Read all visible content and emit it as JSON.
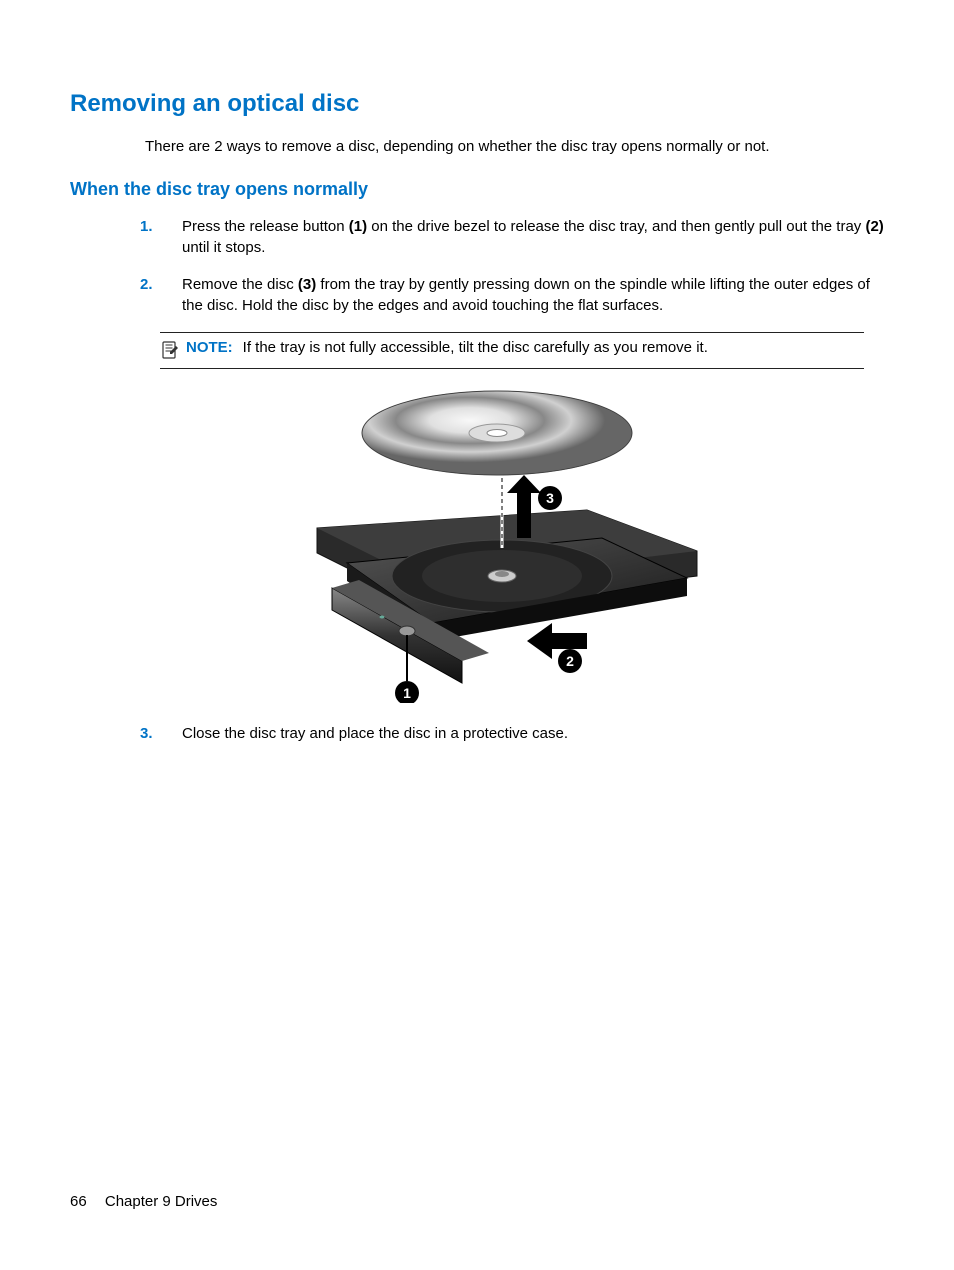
{
  "heading": "Removing an optical disc",
  "intro": "There are 2 ways to remove a disc, depending on whether the disc tray opens normally or not.",
  "subheading": "When the disc tray opens normally",
  "steps": [
    {
      "num": "1.",
      "a": "Press the release button ",
      "b1": "(1)",
      "c": " on the drive bezel to release the disc tray, and then gently pull out the tray ",
      "b2": "(2)",
      "d": " until it stops."
    },
    {
      "num": "2.",
      "a": "Remove the disc ",
      "b1": "(3)",
      "c": " from the tray by gently pressing down on the spindle while lifting the outer edges of the disc. Hold the disc by the edges and avoid touching the flat surfaces."
    },
    {
      "num": "3.",
      "a": "Close the disc tray and place the disc in a protective case."
    }
  ],
  "note_label": "NOTE:",
  "note_text": "If the tray is not fully accessible, tilt the disc carefully as you remove it.",
  "callouts": {
    "c1": "1",
    "c2": "2",
    "c3": "3"
  },
  "footer": {
    "page": "66",
    "chapter": "Chapter 9   Drives"
  }
}
